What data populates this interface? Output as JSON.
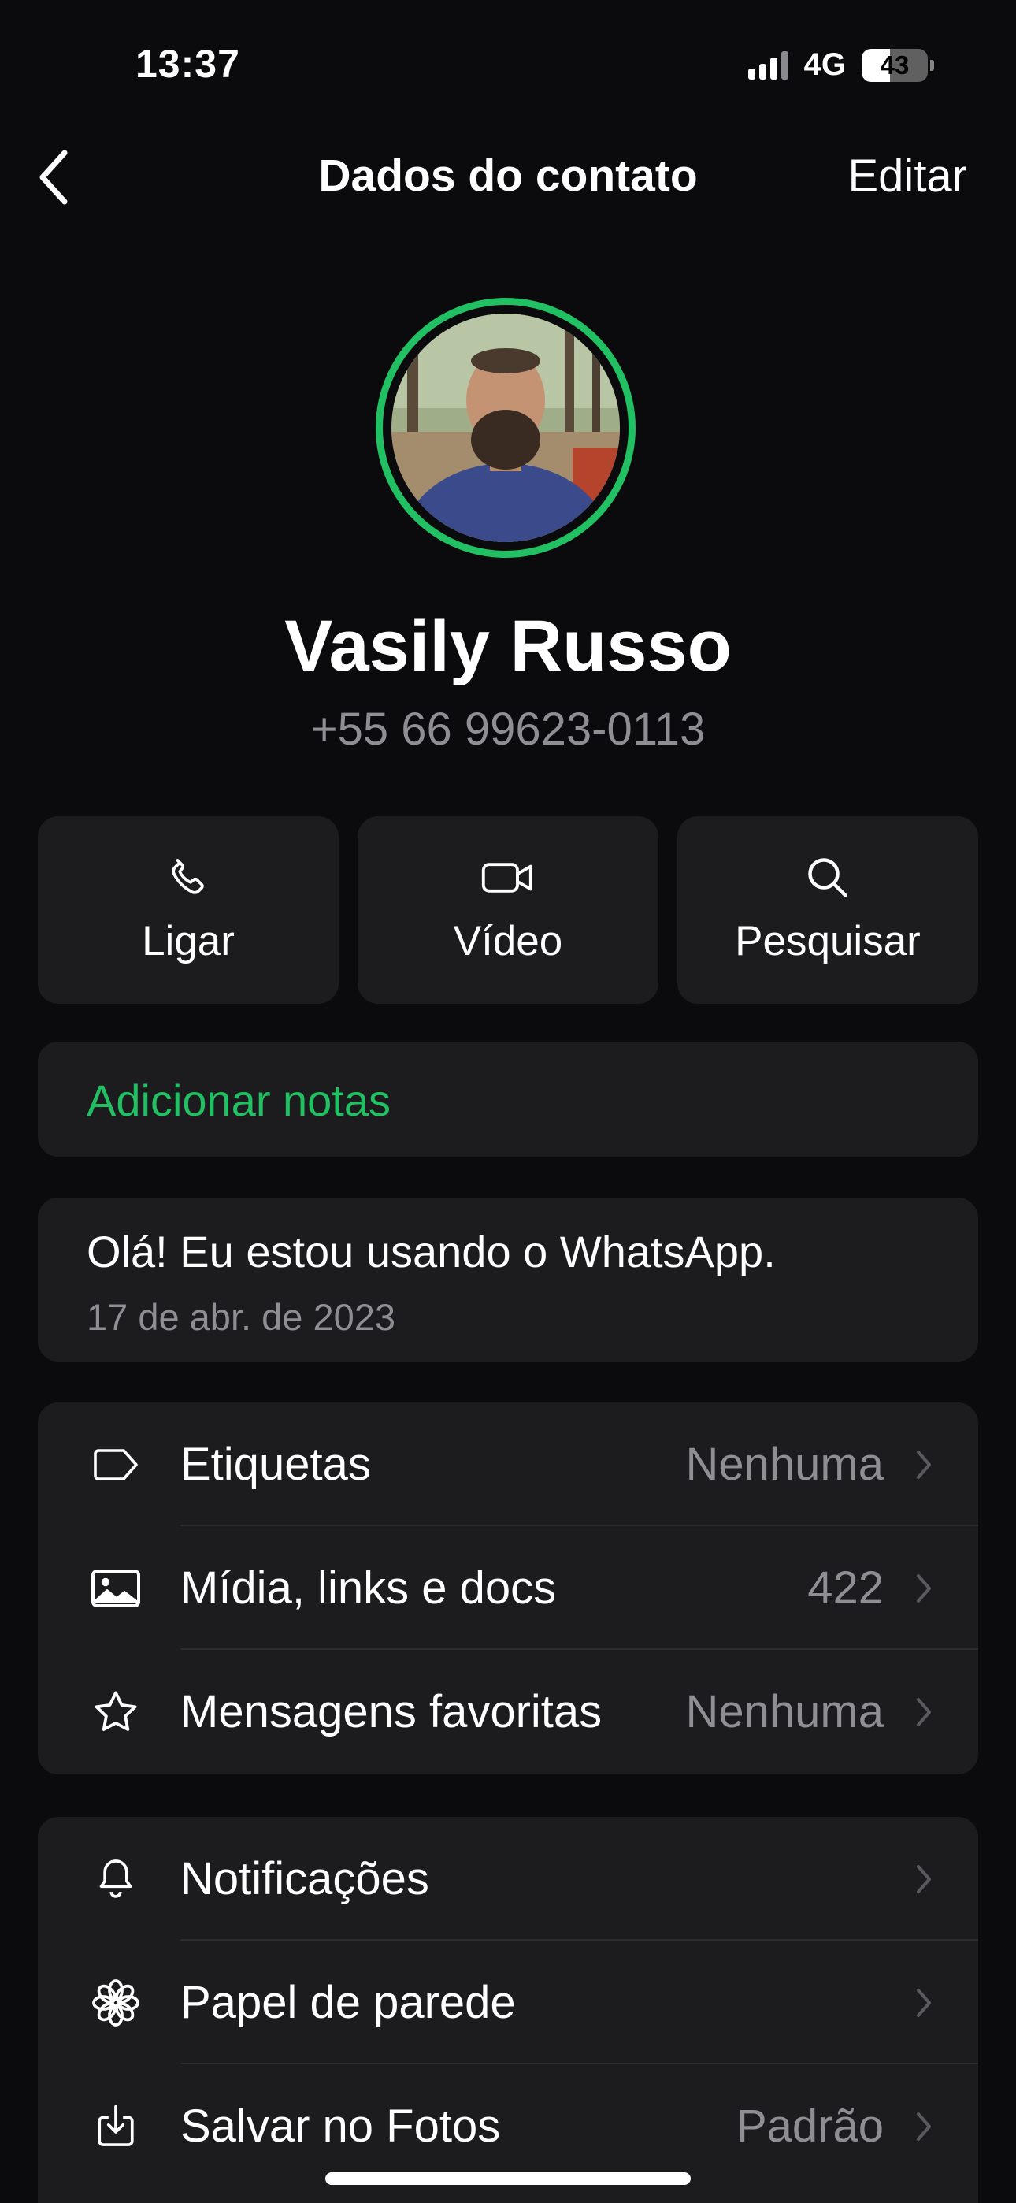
{
  "status_bar": {
    "time": "13:37",
    "network": "4G",
    "battery": "43"
  },
  "nav": {
    "title": "Dados do contato",
    "edit_label": "Editar"
  },
  "contact": {
    "name": "Vasily Russo",
    "phone": "+55 66 99623-0113"
  },
  "actions": [
    {
      "label": "Ligar",
      "icon": "phone-icon"
    },
    {
      "label": "Vídeo",
      "icon": "video-icon"
    },
    {
      "label": "Pesquisar",
      "icon": "search-icon"
    }
  ],
  "notes": {
    "label": "Adicionar notas"
  },
  "about": {
    "text": "Olá! Eu estou usando o WhatsApp.",
    "date": "17 de abr. de 2023"
  },
  "list1": [
    {
      "label": "Etiquetas",
      "value": "Nenhuma",
      "icon": "tag-icon"
    },
    {
      "label": "Mídia, links e docs",
      "value": "422",
      "icon": "image-icon"
    },
    {
      "label": "Mensagens favoritas",
      "value": "Nenhuma",
      "icon": "star-icon"
    }
  ],
  "list2": [
    {
      "label": "Notificações",
      "value": "",
      "icon": "bell-icon"
    },
    {
      "label": "Papel de parede",
      "value": "",
      "icon": "flower-icon"
    },
    {
      "label": "Salvar no Fotos",
      "value": "Padrão",
      "icon": "save-icon"
    }
  ],
  "colors": {
    "accent": "#21c063",
    "background": "#0b0b0d",
    "card": "#1c1c1e",
    "secondary_text": "#8e8e93"
  }
}
